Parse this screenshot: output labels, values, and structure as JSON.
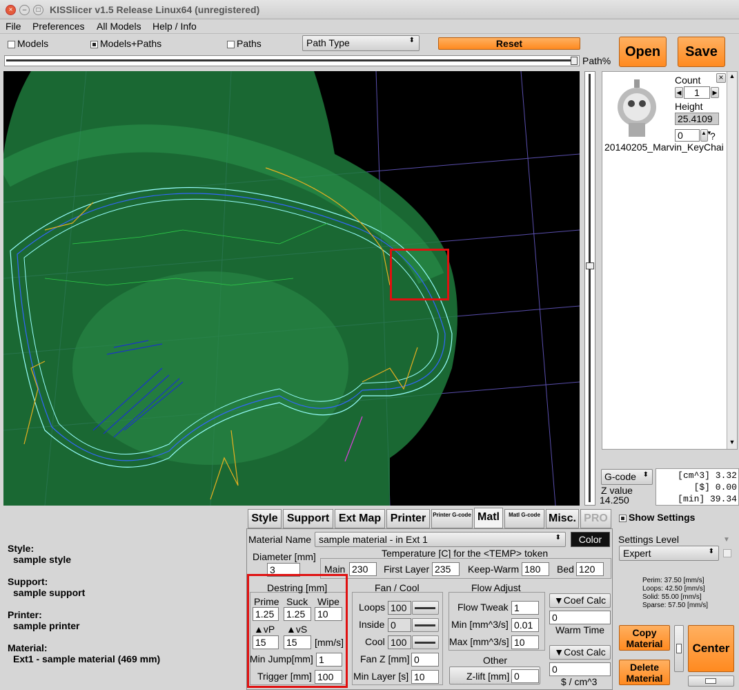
{
  "window": {
    "title": "KISSlicer v1.5 Release Linux64 (unregistered)"
  },
  "menu": [
    "File",
    "Preferences",
    "All Models",
    "Help / Info"
  ],
  "toolbar": {
    "models": "Models",
    "models_paths": "Models+Paths",
    "paths": "Paths",
    "path_type": "Path Type",
    "reset": "Reset",
    "open": "Open",
    "save": "Save",
    "path_pct": "Path%"
  },
  "model": {
    "count_label": "Count",
    "count": "1",
    "height_label": "Height",
    "height": "25.4109",
    "zero": "0",
    "q": "?",
    "name": "20140205_Marvin_KeyChai"
  },
  "gcode": {
    "label": "G-code",
    "zlabel": "Z value",
    "z": "14.250",
    "stats": [
      "[cm^3]  3.32",
      "[$]  0.00",
      "[min]  39.34"
    ]
  },
  "tabs": [
    "Style",
    "Support",
    "Ext Map",
    "Printer",
    "Printer G-code",
    "Matl",
    "Matl G-code",
    "Misc.",
    "PRO"
  ],
  "show_settings": "Show Settings",
  "summary": {
    "style_h": "Style:",
    "style_v": "sample style",
    "support_h": "Support:",
    "support_v": "sample support",
    "printer_h": "Printer:",
    "printer_v": "sample printer",
    "material_h": "Material:",
    "material_v": "Ext1 - sample material (469 mm)"
  },
  "matl": {
    "name_label": "Material Name",
    "name": "sample material - in Ext 1",
    "color": "Color",
    "diam_label": "Diameter [mm]",
    "diam": "3",
    "temp_title": "Temperature [C] for the <TEMP> token",
    "main_l": "Main",
    "main": "230",
    "first_l": "First Layer",
    "first": "235",
    "keep_l": "Keep-Warm",
    "keep": "180",
    "bed_l": "Bed",
    "bed": "120"
  },
  "destring": {
    "title": "Destring [mm]",
    "prime_l": "Prime",
    "suck_l": "Suck",
    "wipe_l": "Wipe",
    "prime": "1.25",
    "suck": "1.25",
    "wipe": "10",
    "vp_l": "vP",
    "vs_l": "vS",
    "vp": "15",
    "vs": "15",
    "mms": "[mm/s]",
    "minjump_l": "Min Jump[mm]",
    "minjump": "1",
    "trigger_l": "Trigger [mm]",
    "trigger": "100"
  },
  "fan": {
    "title": "Fan / Cool",
    "loops_l": "Loops",
    "loops": "100",
    "inside_l": "Inside",
    "inside": "0",
    "cool_l": "Cool",
    "cool": "100",
    "fanz_l": "Fan Z [mm]",
    "fanz": "0",
    "minlayer_l": "Min Layer [s]",
    "minlayer": "10"
  },
  "flow": {
    "title": "Flow Adjust",
    "tweak_l": "Flow Tweak",
    "tweak": "1",
    "min_l": "Min [mm^3/s]",
    "min": "0.01",
    "max_l": "Max [mm^3/s]",
    "max": "10",
    "coef": "Coef Calc",
    "coefv": "0",
    "warm": "Warm Time",
    "cost": "Cost Calc",
    "costv": "0",
    "costunit": "$ / cm^3",
    "other": "Other",
    "zlift_l": "Z-lift [mm]",
    "zlift": "0"
  },
  "settings": {
    "level_l": "Settings Level",
    "level": "Expert",
    "speeds": [
      "Perim:  37.50 [mm/s]",
      "Loops:  42.50 [mm/s]",
      "Solid:  55.00 [mm/s]",
      "Sparse: 57.50 [mm/s]"
    ]
  },
  "actions": {
    "copy": "Copy Material",
    "delete": "Delete Material",
    "center": "Center"
  }
}
